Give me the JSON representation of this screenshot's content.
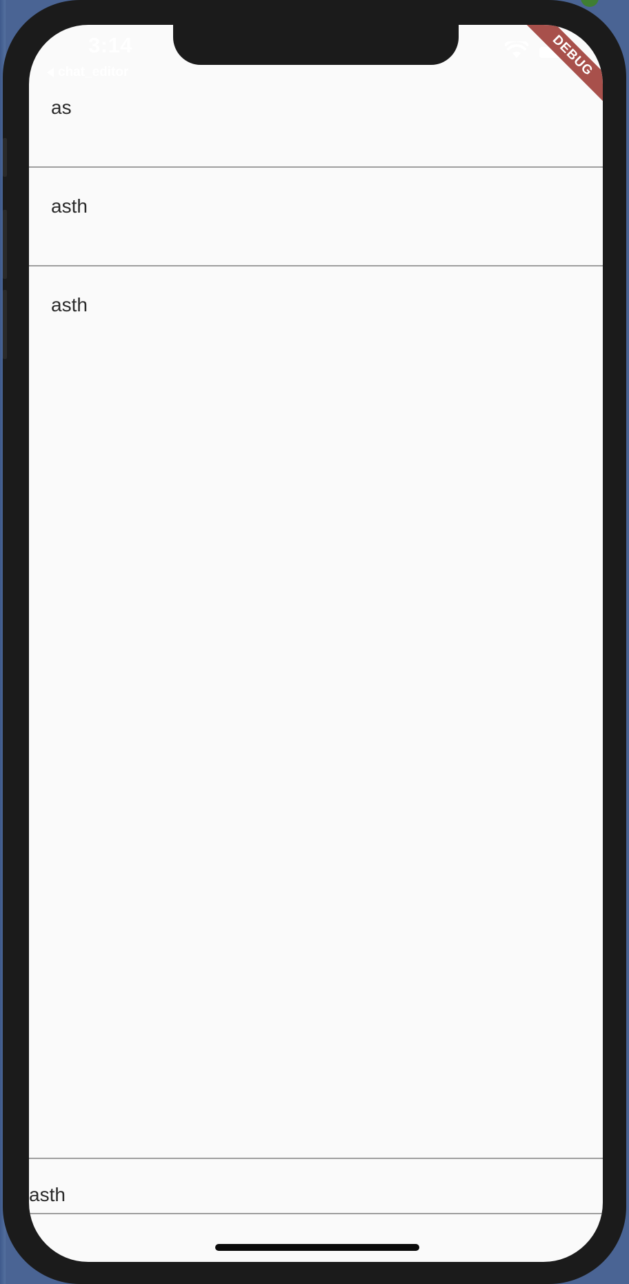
{
  "status_bar": {
    "time": "3:14",
    "back_label": "chat_editor",
    "wifi_icon": "wifi-icon",
    "battery_icon": "battery-icon"
  },
  "debug_banner": "DEBUG",
  "messages": [
    {
      "text": "as"
    },
    {
      "text": "asth"
    },
    {
      "text": "asth"
    }
  ],
  "input": {
    "value": "asth"
  },
  "colors": {
    "background": "#fafafa",
    "divider": "#9e9e9e",
    "debug_banner": "#a8504b",
    "device_frame": "#1b1b1b"
  }
}
